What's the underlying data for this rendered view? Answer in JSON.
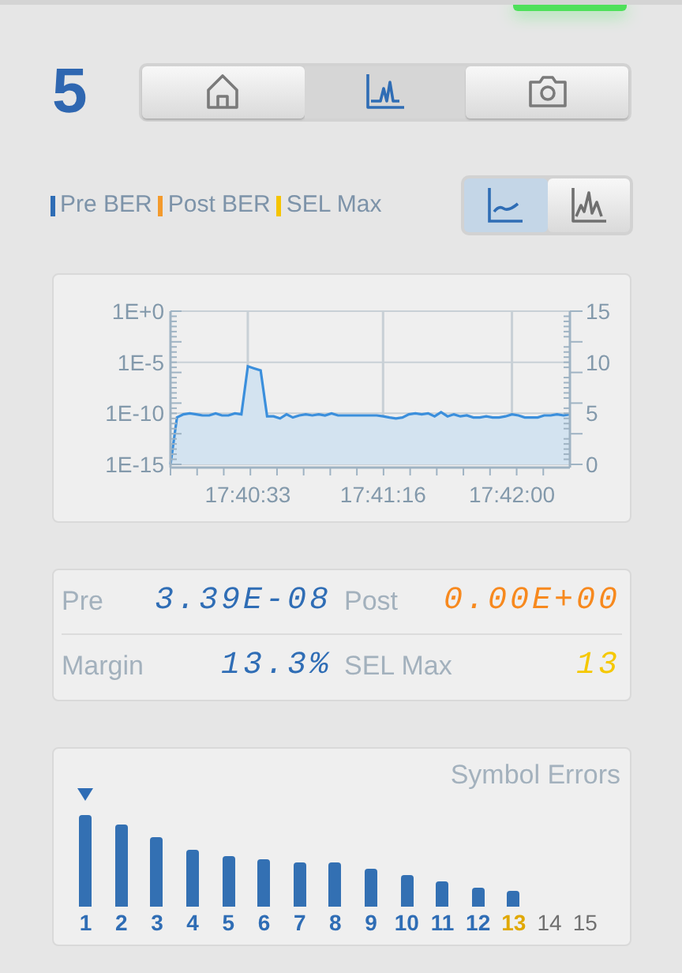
{
  "channel_number": "5",
  "view_tabs": [
    {
      "kind": "home",
      "selected": false
    },
    {
      "kind": "spectrum",
      "selected": true
    },
    {
      "kind": "camera",
      "selected": false
    }
  ],
  "legend": [
    {
      "label": "Pre BER",
      "color": "#2f6db5"
    },
    {
      "label": "Post BER",
      "color": "#f39a2c"
    },
    {
      "label": "SEL Max",
      "color": "#f5c400"
    }
  ],
  "chart_modes": [
    {
      "kind": "line",
      "selected": true
    },
    {
      "kind": "peaks",
      "selected": false
    }
  ],
  "ber_chart": {
    "left_axis_labels": [
      "1E+0",
      "1E-5",
      "1E-10",
      "1E-15"
    ],
    "chart_data": {
      "type": "area",
      "categories": [
        null,
        null,
        null,
        null,
        null,
        null,
        null,
        null,
        null,
        null,
        null,
        null,
        "17:40:33",
        null,
        null,
        null,
        null,
        null,
        null,
        null,
        null,
        null,
        null,
        null,
        null,
        null,
        null,
        null,
        null,
        null,
        null,
        null,
        null,
        "17:41:16",
        null,
        null,
        null,
        null,
        null,
        null,
        null,
        null,
        null,
        null,
        null,
        null,
        null,
        null,
        null,
        null,
        null,
        null,
        null,
        "17:42:00",
        null,
        null,
        null,
        null,
        null,
        null,
        null,
        null,
        null
      ],
      "series": [
        {
          "color": "#3b8fdc",
          "values": [
            0,
            4.6,
            4.9,
            5.0,
            4.9,
            4.8,
            4.8,
            5.0,
            4.8,
            4.8,
            5.0,
            4.9,
            9.6,
            9.4,
            9.2,
            4.7,
            4.7,
            4.5,
            4.9,
            4.6,
            4.8,
            4.9,
            4.8,
            4.9,
            4.8,
            5.0,
            4.8,
            4.8,
            4.8,
            4.8,
            4.8,
            4.8,
            4.8,
            4.7,
            4.6,
            4.5,
            4.6,
            4.9,
            5.0,
            4.9,
            5.0,
            4.7,
            5.1,
            4.7,
            4.9,
            4.7,
            4.8,
            4.6,
            4.6,
            4.7,
            4.6,
            4.6,
            4.7,
            4.9,
            4.8,
            4.6,
            4.6,
            4.6,
            4.8,
            4.8,
            4.9,
            4.8,
            4.9
          ]
        }
      ],
      "ylim": [
        0,
        15
      ],
      "yticks": [
        0,
        5,
        10,
        15
      ],
      "grid": true
    }
  },
  "stats": [
    {
      "label": "Pre",
      "value": "3.39E-08",
      "color": "#2f6db5"
    },
    {
      "label": "Post",
      "value": "0.00E+00",
      "color": "#f7891e"
    },
    {
      "label": "Margin",
      "value": "13.3%",
      "color": "#2f6db5"
    },
    {
      "label": "SEL Max",
      "value": "13",
      "color": "#f5c800"
    }
  ],
  "symbol_errors": {
    "title": "Symbol Errors",
    "columns": [
      {
        "label": "1",
        "color": "#2f6db5",
        "marked": true
      },
      {
        "label": "2",
        "color": "#2f6db5",
        "marked": false
      },
      {
        "label": "3",
        "color": "#2f6db5",
        "marked": false
      },
      {
        "label": "4",
        "color": "#2f6db5",
        "marked": false
      },
      {
        "label": "5",
        "color": "#2f6db5",
        "marked": false
      },
      {
        "label": "6",
        "color": "#2f6db5",
        "marked": false
      },
      {
        "label": "7",
        "color": "#2f6db5",
        "marked": false
      },
      {
        "label": "8",
        "color": "#2f6db5",
        "marked": false
      },
      {
        "label": "9",
        "color": "#2f6db5",
        "marked": false
      },
      {
        "label": "10",
        "color": "#2f6db5",
        "marked": false
      },
      {
        "label": "11",
        "color": "#2f6db5",
        "marked": false
      },
      {
        "label": "12",
        "color": "#2f6db5",
        "marked": false
      },
      {
        "label": "13",
        "color": "#e0a800",
        "marked": false
      },
      {
        "label": "14",
        "color": "#707070",
        "marked": false
      },
      {
        "label": "15",
        "color": "#707070",
        "marked": false
      }
    ]
  }
}
